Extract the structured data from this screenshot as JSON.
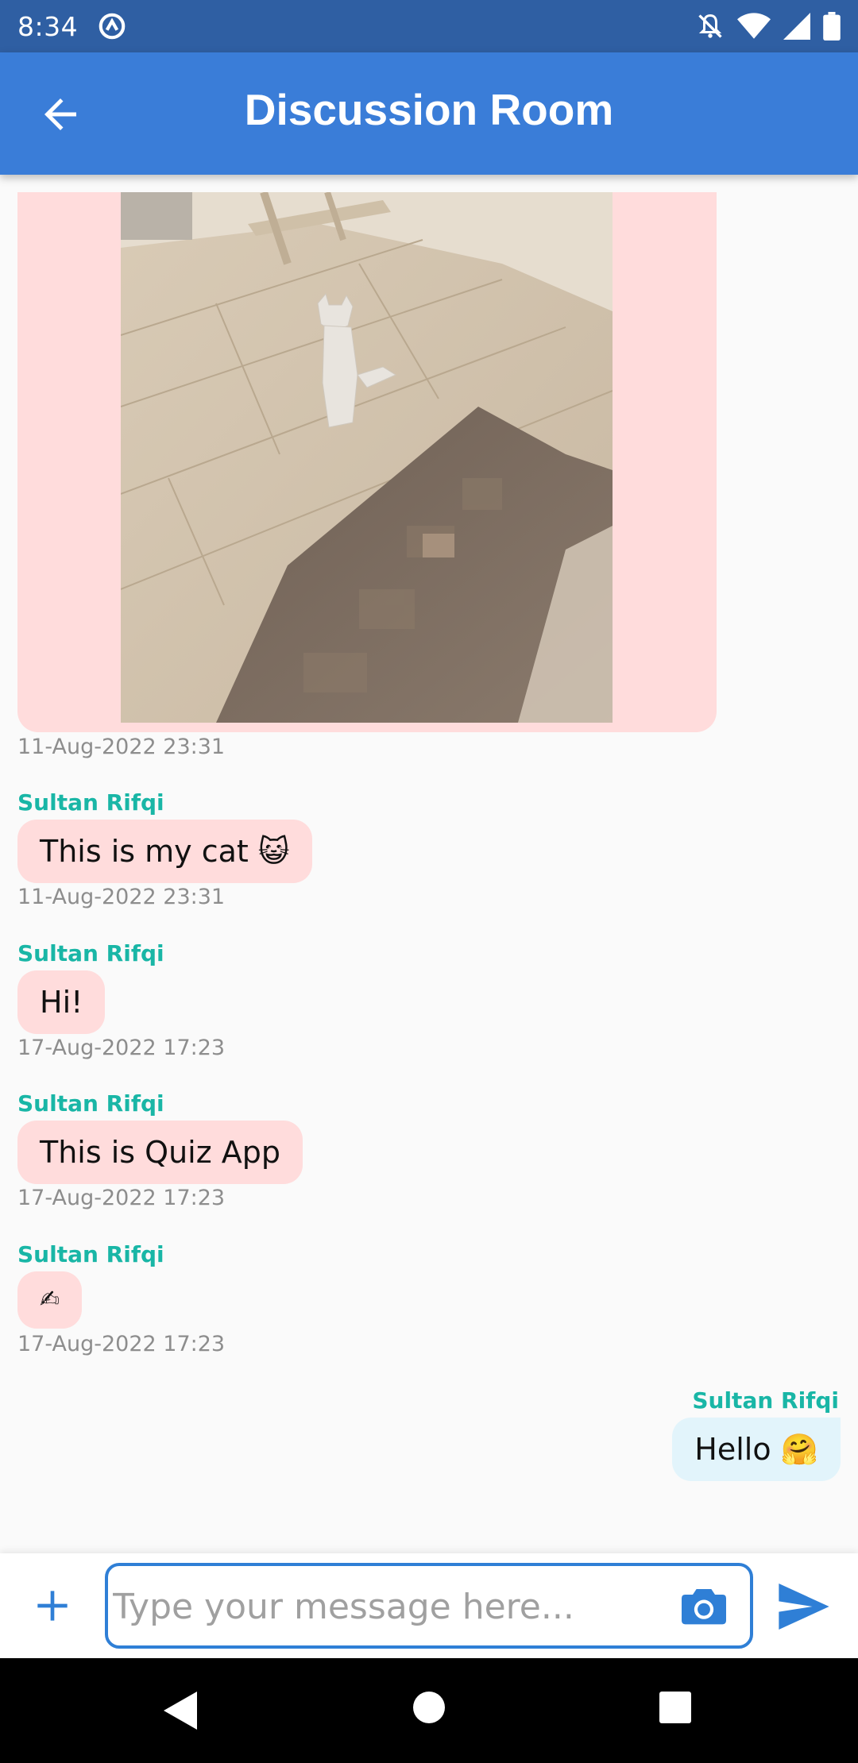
{
  "status_bar": {
    "time": "8:34",
    "icons": [
      "sync-icon",
      "notifications-off-icon",
      "wifi-icon",
      "signal-icon",
      "battery-icon"
    ]
  },
  "app_bar": {
    "title": "Discussion Room",
    "back_icon": "arrow-back-icon",
    "color": "#3a7dd8"
  },
  "messages": [
    {
      "sender": "",
      "type": "image",
      "image_desc": "cat",
      "timestamp": "11-Aug-2022 23:31",
      "side": "left"
    },
    {
      "sender": "Sultan Rifqi",
      "type": "text",
      "text": "This is my cat 😺",
      "timestamp": "11-Aug-2022 23:31",
      "side": "left"
    },
    {
      "sender": "Sultan Rifqi",
      "type": "text",
      "text": "Hi!",
      "timestamp": "17-Aug-2022 17:23",
      "side": "left"
    },
    {
      "sender": "Sultan Rifqi",
      "type": "text",
      "text": "This is Quiz App",
      "timestamp": "17-Aug-2022 17:23",
      "side": "left"
    },
    {
      "sender": "Sultan Rifqi",
      "type": "text",
      "text": "✍",
      "timestamp": "17-Aug-2022 17:23",
      "side": "left"
    },
    {
      "sender": "Sultan Rifqi",
      "type": "text",
      "text": "Hello 🤗",
      "timestamp": "",
      "side": "right"
    }
  ],
  "composer": {
    "placeholder": "Type your message here...",
    "plus_icon": "add-icon",
    "camera_icon": "camera-icon",
    "send_icon": "send-icon"
  },
  "colors": {
    "incoming_bubble": "#ffdcdc",
    "outgoing_bubble": "#e2f4fb",
    "sender_name": "#19b6a6",
    "accent": "#2f7fd6"
  },
  "nav_bar": [
    "back-triangle-icon",
    "home-circle-icon",
    "recents-square-icon"
  ]
}
